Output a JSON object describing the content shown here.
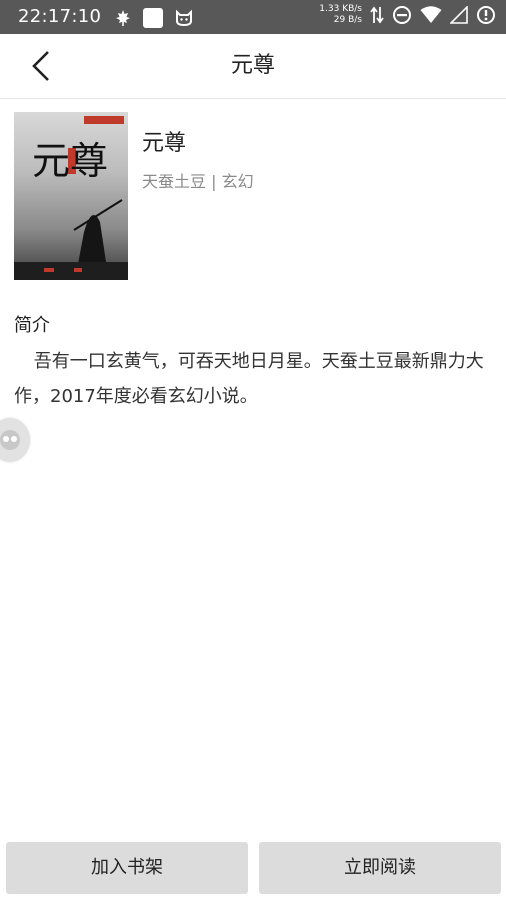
{
  "status_bar": {
    "time": "22:17:10",
    "upload_speed": "1.33 KB/s",
    "download_speed": "29 B/s",
    "icons": [
      "maple-leaf-icon",
      "square-app-icon",
      "cat-face-icon",
      "data-transfer-icon",
      "do-not-disturb-icon",
      "wifi-icon",
      "signal-icon",
      "sync-icon"
    ]
  },
  "header": {
    "title": "元尊",
    "back_icon": "chevron-left-icon"
  },
  "book": {
    "title": "元尊",
    "author": "天蚕土豆",
    "separator": "|",
    "genre": "玄幻",
    "cover_calligraphy": "元尊"
  },
  "intro": {
    "label": "简介",
    "text": "吾有一口玄黄气，可吞天地日月星。天蚕土豆最新鼎力大作，2017年度必看玄幻小说。"
  },
  "actions": {
    "add_to_shelf": "加入书架",
    "read_now": "立即阅读"
  },
  "colors": {
    "status_bar_bg": "#585858",
    "button_bg": "#dcdcdc",
    "meta_text": "#8a8a8a"
  }
}
